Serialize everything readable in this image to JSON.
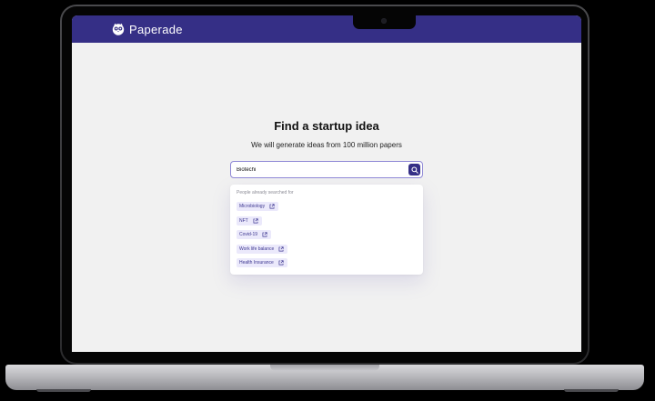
{
  "app": {
    "name": "Paperade",
    "brand_color": "#352f86",
    "logo_icon": "owl-logo-icon"
  },
  "hero": {
    "title": "Find a startup idea",
    "subtitle": "We will generate ideas from 100 million papers"
  },
  "search": {
    "value": "Biotechi",
    "button_icon": "search-icon"
  },
  "suggestions": {
    "caption": "People already searched for",
    "link_icon": "external-link-icon",
    "items": [
      {
        "label": "Microbiology"
      },
      {
        "label": "NFT"
      },
      {
        "label": "Covid-19"
      },
      {
        "label": "Work life balance"
      },
      {
        "label": "Health Insurance"
      }
    ]
  }
}
